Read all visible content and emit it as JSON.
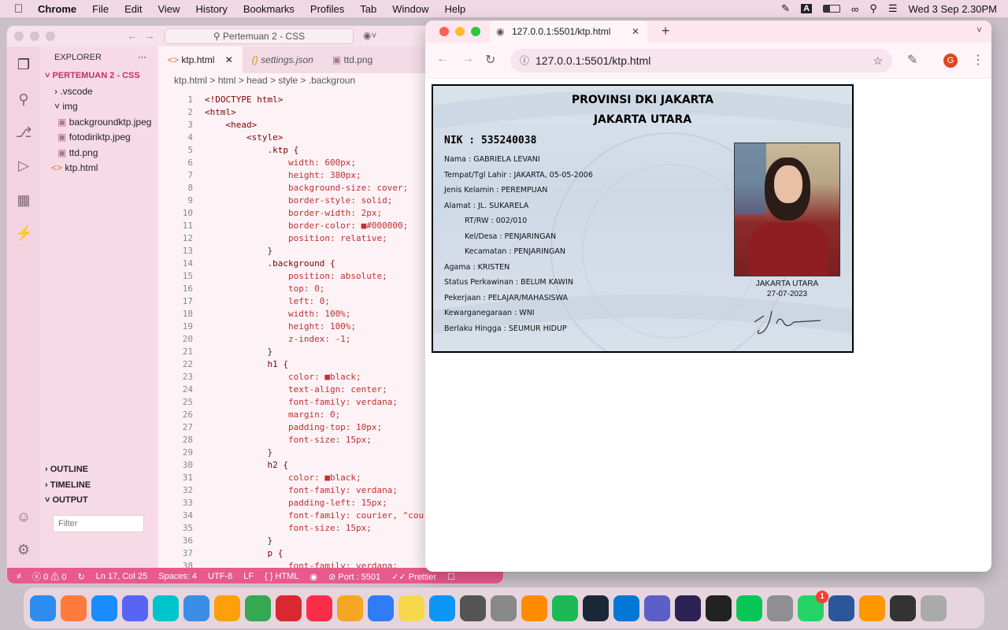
{
  "menubar": {
    "app": "Chrome",
    "items": [
      "File",
      "Edit",
      "View",
      "History",
      "Bookmarks",
      "Profiles",
      "Tab",
      "Window",
      "Help"
    ],
    "datetime": "Wed 3 Sep  2.30PM",
    "input_indicator": "A"
  },
  "vscode": {
    "search": "Pertemuan 2 - CSS",
    "explorer_title": "EXPLORER",
    "folder": "PERTEMUAN 2 - CSS",
    "tree": [
      {
        "label": ".vscode",
        "indent": 1
      },
      {
        "label": "img",
        "indent": 1
      },
      {
        "label": "backgroundktp.jpeg",
        "indent": 2
      },
      {
        "label": "fotodiriktp.jpeg",
        "indent": 2
      },
      {
        "label": "ttd.png",
        "indent": 2
      },
      {
        "label": "ktp.html",
        "indent": 1
      }
    ],
    "sections": [
      "OUTLINE",
      "TIMELINE",
      "OUTPUT"
    ],
    "filter_placeholder": "Filter",
    "tabs": [
      "ktp.html",
      "settings.json",
      "ttd.png"
    ],
    "breadcrumb": "ktp.html > html > head > style > .backgroun",
    "code_start_line": 1,
    "code": [
      "<!DOCTYPE html>",
      "<html>",
      "    <head>",
      "        <style>",
      "            .ktp {",
      "                width: 600px;",
      "                height: 380px;",
      "                background-size: cover;",
      "                border-style: solid;",
      "                border-width: 2px;",
      "                border-color: ■#000000;",
      "                position: relative;",
      "            }",
      "            .background {",
      "                position: absolute;",
      "                top: 0;",
      "                left: 0;",
      "                width: 100%;",
      "                height: 100%;",
      "                z-index: -1;",
      "            }",
      "            h1 {",
      "                color: ■black;",
      "                text-align: center;",
      "                font-family: verdana;",
      "                margin: 0;",
      "                padding-top: 10px;",
      "                font-size: 15px;",
      "            }",
      "            h2 {",
      "                color: ■black;",
      "                font-family: verdana;",
      "                padding-left: 15px;",
      "                font-family: courier, \"couri",
      "                font-size: 15px;",
      "            }",
      "            p {",
      "                font-family: verdana;"
    ],
    "status": {
      "errors": "ⓧ 0 ⚠ 0",
      "position": "Ln 17, Col 25",
      "spaces": "Spaces: 4",
      "encoding": "UTF-8",
      "eol": "LF",
      "language": "HTML",
      "port": "Port : 5501",
      "prettier": "Prettier"
    },
    "accent": "#e85a8c"
  },
  "chrome": {
    "tab_title": "127.0.0.1:5501/ktp.html",
    "url": "127.0.0.1:5501/ktp.html",
    "profile_initial": "G"
  },
  "ktp": {
    "province": "PROVINSI DKI JAKARTA",
    "city": "JAKARTA UTARA",
    "nik": "NIK : 535240038",
    "fields": [
      "Nama : GABRIELA LEVANI",
      "Tempat/Tgl Lahir : JAKARTA, 05-05-2006",
      "Jenis Kelamin : PEREMPUAN",
      "Alamat : JL. SUKARELA",
      "RT/RW : 002/010",
      "Kel/Desa : PENJARINGAN",
      "Kecamatan : PENJARINGAN",
      "Agama : KRISTEN",
      "Status Perkawinan : BELUM KAWIN",
      "Pekerjaan : PELAJAR/MAHASISWA",
      "Kewarganegaraan : WNI",
      "Berlaku Hingga : SEUMUR HIDUP"
    ],
    "issue_city": "JAKARTA UTARA",
    "issue_date": "27-07-2023"
  },
  "dock": {
    "apps": [
      "finder",
      "launchpad",
      "safari",
      "discord",
      "canva",
      "mail",
      "photos",
      "chrome",
      "toolbox",
      "music",
      "reminders",
      "other",
      "notes",
      "app-store",
      "calculator",
      "settings",
      "books",
      "spotify",
      "steam",
      "vscode",
      "teams",
      "eclipse",
      "chatgpt",
      "line",
      "system-settings",
      "whatsapp",
      "word",
      "sublime",
      "phone",
      "trash"
    ],
    "whatsapp_badge": "1"
  }
}
